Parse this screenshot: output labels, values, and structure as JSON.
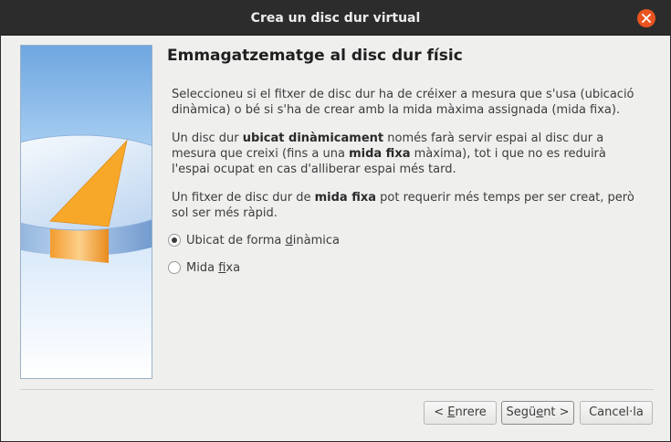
{
  "window": {
    "title": "Crea un disc dur virtual"
  },
  "page": {
    "heading": "Emmagatzematge al disc dur físic",
    "para1": "Seleccioneu si el fitxer de disc dur ha de créixer a mesura que s'usa (ubicació dinàmica) o bé si s'ha de crear amb la mida màxima assignada (mida fixa).",
    "para2": {
      "l1_a": "Un disc dur ",
      "l1_b": "ubicat dinàmicament",
      "l1_c": " només farà servir espai al disc dur a",
      "l2_a": "mesura que creixi (fins a una ",
      "l2_b": "mida fixa",
      "l2_c": " màxima), tot i que no es reduirà",
      "l3": "l'espai ocupat en cas d'alliberar espai més tard."
    },
    "para3": {
      "l1_a": "Un fitxer de disc dur de ",
      "l1_b": "mida fixa",
      "l1_c": " pot requerir més temps per ser creat, però",
      "l2": "sol ser més ràpid."
    }
  },
  "options": {
    "dynamic": {
      "pre": "Ubicat de forma ",
      "mn": "d",
      "post": "inàmica",
      "checked": true
    },
    "fixed": {
      "pre": "Mida ",
      "mn": "f",
      "post": "ixa",
      "checked": false
    }
  },
  "buttons": {
    "back": {
      "pre": "< ",
      "mn": "E",
      "post": "nrere"
    },
    "next": {
      "pre": "Segü",
      "mn": "e",
      "post": "nt >"
    },
    "cancel": "Cancel·la"
  },
  "colors": {
    "titlebar": "#2c2c2c",
    "close": "#e95420",
    "window_bg": "#efefee",
    "pie_orange": "#f7a829"
  },
  "icons": {
    "close": "close-icon",
    "side_image": "hard-disk-pie-illustration"
  }
}
